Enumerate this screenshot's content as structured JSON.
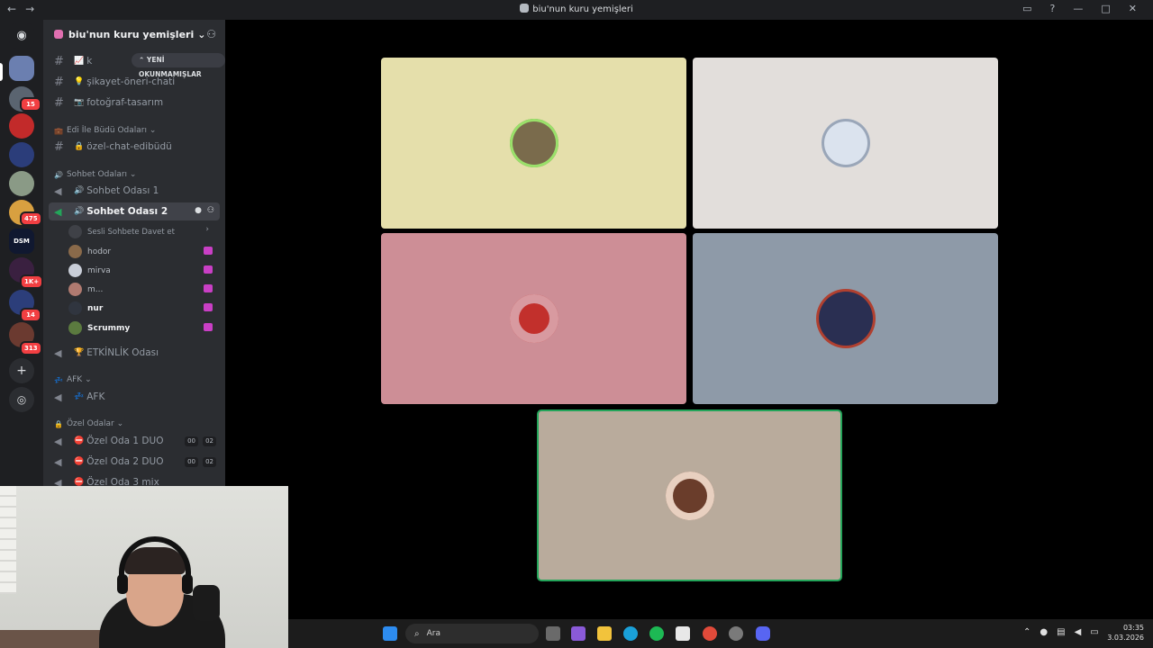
{
  "window": {
    "title": "biu'nun kuru yemişleri",
    "back": "←",
    "forward": "→"
  },
  "server_badges": [
    "15",
    "475",
    "1K+",
    "14",
    "313"
  ],
  "guild": {
    "name": "biu'nun kuru yemişleri",
    "chevron": "⌄",
    "tooltip": "⌃ YENİ OKUNMAMIŞLAR"
  },
  "channels": {
    "top": [
      {
        "prefix": "#",
        "emoji": "📈",
        "name": "k"
      },
      {
        "prefix": "#",
        "emoji": "💡",
        "name": "şikayet-öneri-chati"
      },
      {
        "prefix": "#",
        "emoji": "📷",
        "name": "fotoğraf-tasarım"
      }
    ],
    "cat1": {
      "emoji": "💼",
      "name": "Edi İle Büdü Odaları ⌄"
    },
    "cat1_channels": [
      {
        "prefix": "#",
        "emoji": "🔒",
        "name": "özel-chat-edibüdü"
      }
    ],
    "cat2": {
      "emoji": "🔊",
      "name": "Sohbet Odaları ⌄"
    },
    "voice1": {
      "emoji": "🔊",
      "name": "Sohbet Odası 1"
    },
    "voice2": {
      "emoji": "🔊",
      "name": "Sohbet Odası 2"
    },
    "invite_label": "Sesli Sohbete Davet et",
    "invite_chev": "›",
    "members": [
      {
        "name": "hodor",
        "color": "#8a6a4a"
      },
      {
        "name": "mirva",
        "color": "#c9ced8"
      },
      {
        "name": "m...",
        "color": "#b07a70"
      },
      {
        "name": "nur",
        "color": "#30353f"
      },
      {
        "name": "Scrummy",
        "color": "#5b7a3f"
      }
    ],
    "voice3": {
      "emoji": "🏆",
      "name": "ETKİNLİK Odası"
    },
    "cat3": {
      "emoji": "💤",
      "name": "AFK ⌄"
    },
    "afk": {
      "emoji": "💤",
      "name": "AFK"
    },
    "cat4": {
      "emoji": "🔒",
      "name": "Özel Odalar ⌄"
    },
    "private": [
      {
        "emoji": "⛔",
        "name": "Özel Oda 1 DUO",
        "c1": "00",
        "c2": "02"
      },
      {
        "emoji": "⛔",
        "name": "Özel Oda 2 DUO",
        "c1": "00",
        "c2": "02"
      },
      {
        "emoji": "⛔",
        "name": "Özel Oda 3 mix",
        "c1": "",
        "c2": ""
      }
    ]
  },
  "tiles": [
    {
      "bg": "#e5dfab",
      "avatar": "#7a6b4c"
    },
    {
      "bg": "#e2dedb",
      "avatar": "#dbe3ee"
    },
    {
      "bg": "#cd8e96",
      "avatar": "#c2302c"
    },
    {
      "bg": "#8e9aa8",
      "avatar": "#2a2f52"
    },
    {
      "bg": "#b9ab9c",
      "avatar": "#6a3d2b"
    }
  ],
  "taskbar": {
    "search": "Ara",
    "time": "03:35",
    "date": "3.03.2026"
  },
  "colors": {
    "speaking": "#23a55a",
    "accent": "#5865f2"
  }
}
